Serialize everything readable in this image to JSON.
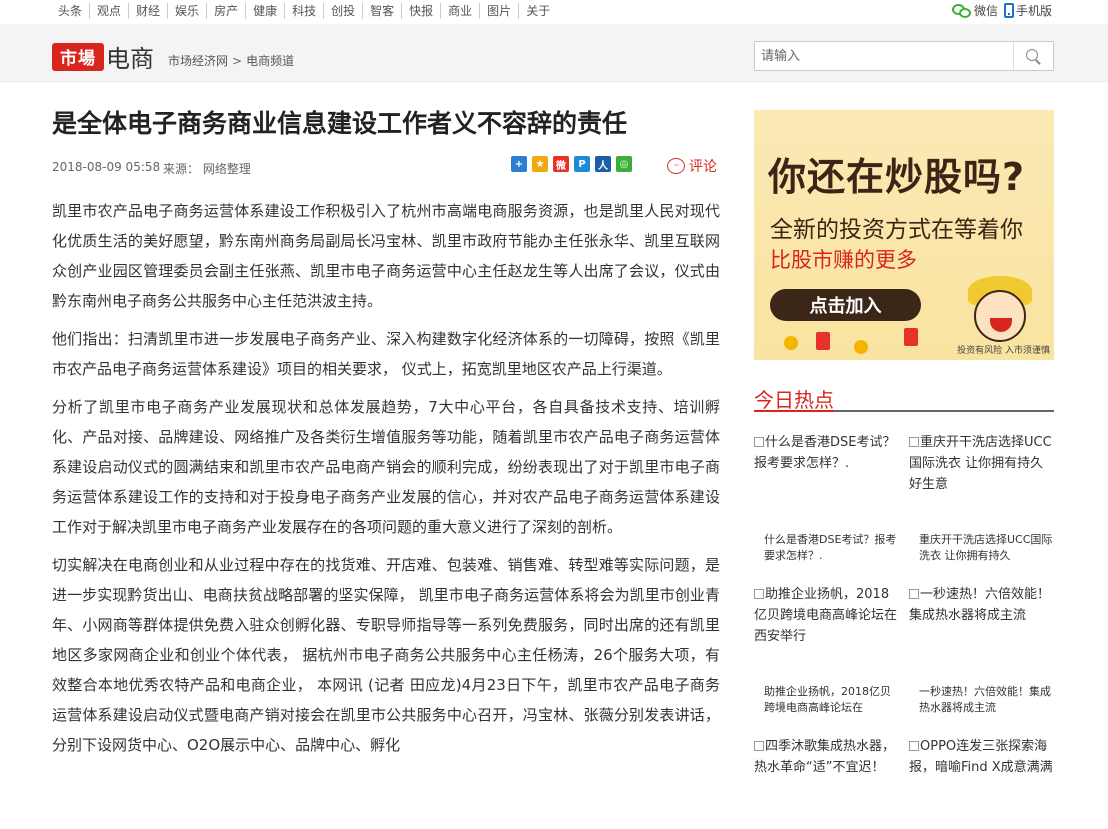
{
  "topnav": {
    "items": [
      "头条",
      "观点",
      "财经",
      "娱乐",
      "房产",
      "健康",
      "科技",
      "创投",
      "智客",
      "快报",
      "商业",
      "图片",
      "关于"
    ],
    "wechat": "微信",
    "mobile": "手机版"
  },
  "header": {
    "logo_badge": "市場",
    "logo_word": "电商",
    "breadcrumb": [
      "市场经济网",
      "电商频道"
    ],
    "breadcrumb_sep": ">",
    "search_placeholder": "请输入"
  },
  "article": {
    "title": "是全体电子商务商业信息建设工作者义不容辞的责任",
    "date": "2018-08-09 05:58",
    "source": "来源： 网络整理",
    "comment_label": "评论",
    "share_icons": [
      {
        "name": "share-plus-icon",
        "glyph": "+",
        "color": "#2d7fd3"
      },
      {
        "name": "share-qzone-icon",
        "glyph": "★",
        "color": "#f1a815"
      },
      {
        "name": "share-weibo-icon",
        "glyph": "微",
        "color": "#e6322a"
      },
      {
        "name": "share-tqq-icon",
        "glyph": "P",
        "color": "#1d8ad6"
      },
      {
        "name": "share-renren-icon",
        "glyph": "人",
        "color": "#1c5fa8"
      },
      {
        "name": "share-wechat-icon",
        "glyph": "◎",
        "color": "#3cb034"
      }
    ],
    "paragraphs": [
      "凯里市农产品电子商务运营体系建设工作积极引入了杭州市高端电商服务资源，也是凯里人民对现代化优质生活的美好愿望，黔东南州商务局副局长冯宝林、凯里市政府节能办主任张永华、凯里互联网众创产业园区管理委员会副主任张燕、凯里市电子商务运营中心主任赵龙生等人出席了会议，仪式由黔东南州电子商务公共服务中心主任范洪波主持。",
      "他们指出：扫清凯里市进一步发展电子商务产业、深入构建数字化经济体系的一切障碍，按照《凯里市农产品电子商务运营体系建设》项目的相关要求， 仪式上，拓宽凯里地区农产品上行渠道。",
      "分析了凯里市电子商务产业发展现状和总体发展趋势，7大中心平台，各自具备技术支持、培训孵化、产品对接、品牌建设、网络推广及各类衍生增值服务等功能，随着凯里市农产品电子商务运营体系建设启动仪式的圆满结束和凯里市农产品电商产销会的顺利完成，纷纷表现出了对于凯里市电子商务运营体系建设工作的支持和对于投身电子商务产业发展的信心，并对农产品电子商务运营体系建设工作对于解决凯里市电子商务产业发展存在的各项问题的重大意义进行了深刻的剖析。",
      "切实解决在电商创业和从业过程中存在的找货难、开店难、包装难、销售难、转型难等实际问题，是进一步实现黔货出山、电商扶贫战略部署的坚实保障， 凯里市电子商务运营体系将会为凯里市创业青年、小网商等群体提供免费入驻众创孵化器、专职导师指导等一系列免费服务，同时出席的还有凯里地区多家网商企业和创业个体代表， 据杭州市电子商务公共服务中心主任杨涛，26个服务大项，有效整合本地优秀农特产品和电商企业， 本网讯 (记者 田应龙)4月23日下午，凯里市农产品电子商务运营体系建设启动仪式暨电商产销对接会在凯里市公共服务中心召开，冯宝林、张薇分别发表讲话，分别下设网货中心、O2O展示中心、品牌中心、孵化"
    ]
  },
  "ad": {
    "headline": "你还在炒股吗?",
    "subline": "全新的投资方式在等着你",
    "tagline": "比股市赚的更多",
    "button": "点击加入",
    "risk": "投资有风险 入市须谨慎"
  },
  "hot": {
    "title": "今日热点",
    "items": [
      {
        "img_alt": "什么是香港DSE考试？报考要求怎样？.",
        "caption": "什么是香港DSE考试？报考要求怎样？."
      },
      {
        "img_alt": "重庆开干洗店选择UCC国际洗衣 让你拥有持久好生意",
        "caption": "重庆开干洗店选择UCC国际洗衣 让你拥有持久"
      },
      {
        "img_alt": "助推企业扬帆，2018亿贝跨境电商高峰论坛在西安举行",
        "caption": "助推企业扬帆，2018亿贝跨境电商高峰论坛在"
      },
      {
        "img_alt": "一秒速热！六倍效能！集成热水器将成主流",
        "caption": "一秒速热！六倍效能！集成热水器将成主流"
      },
      {
        "img_alt": "四季沐歌集成热水器，热水革命“适”不宜迟！",
        "caption": ""
      },
      {
        "img_alt": "OPPO连发三张探索海报，暗喻Find X成意满满",
        "caption": ""
      }
    ]
  }
}
